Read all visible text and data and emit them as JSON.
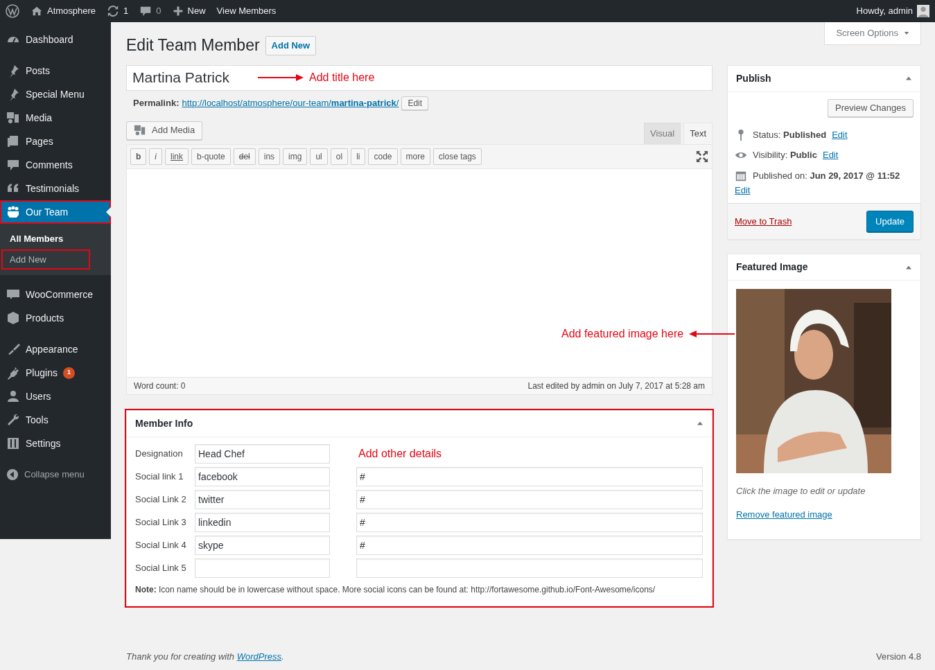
{
  "admin_bar": {
    "site": "Atmosphere",
    "updates": "1",
    "comments": "0",
    "new": "New",
    "view": "View Members",
    "greeting": "Howdy, admin"
  },
  "sidebar": {
    "groups": [
      [
        {
          "label": "Dashboard",
          "selected": false,
          "highlighted": false
        }
      ],
      [
        {
          "label": "Posts",
          "selected": false,
          "highlighted": false
        },
        {
          "label": "Special Menu",
          "selected": false,
          "highlighted": false
        },
        {
          "label": "Media",
          "selected": false,
          "highlighted": false
        },
        {
          "label": "Pages",
          "selected": false,
          "highlighted": false
        },
        {
          "label": "Comments",
          "selected": false,
          "highlighted": false
        },
        {
          "label": "Testimonials",
          "selected": false,
          "highlighted": false
        },
        {
          "label": "Our Team",
          "selected": true,
          "highlighted": true,
          "children": [
            {
              "label": "All Members",
              "selected": true,
              "highlighted": false
            },
            {
              "label": "Add New",
              "selected": false,
              "highlighted": true
            }
          ]
        }
      ],
      [
        {
          "label": "WooCommerce",
          "selected": false,
          "highlighted": false
        },
        {
          "label": "Products",
          "selected": false,
          "highlighted": false
        }
      ],
      [
        {
          "label": "Appearance",
          "selected": false,
          "highlighted": false
        },
        {
          "label": "Plugins",
          "selected": false,
          "highlighted": false,
          "badge": "1"
        },
        {
          "label": "Users",
          "selected": false,
          "highlighted": false
        },
        {
          "label": "Tools",
          "selected": false,
          "highlighted": false
        },
        {
          "label": "Settings",
          "selected": false,
          "highlighted": false
        }
      ]
    ],
    "collapse": "Collapse menu"
  },
  "screen_options": "Screen Options",
  "page": {
    "title": "Edit Team Member",
    "add_new": "Add New"
  },
  "post_title": {
    "value": "Martina Patrick"
  },
  "permalink": {
    "label": "Permalink:",
    "url": "http://localhost/atmosphere/our-team/**martina-patrick**/",
    "edit": "Edit"
  },
  "editor": {
    "add_media": "Add Media",
    "tabs": [
      {
        "label": "Visual",
        "selected": false
      },
      {
        "label": "Text",
        "selected": true
      }
    ],
    "quicktags": [
      "b",
      "i",
      "link",
      "b-quote",
      "del",
      "ins",
      "img",
      "ul",
      "ol",
      "li",
      "code",
      "more",
      "close tags"
    ],
    "word_count": "Word count: 0",
    "last_edited": "Last edited by admin on July 7, 2017 at 5:28 am"
  },
  "member_info": {
    "title": "Member Info",
    "highlighted": true,
    "rows": [
      {
        "kind": "text",
        "label": "Designation",
        "name": "Head Chef"
      },
      {
        "kind": "social",
        "label": "Social link 1",
        "name": "facebook",
        "url": "#"
      },
      {
        "kind": "social",
        "label": "Social Link 2",
        "name": "twitter",
        "url": "#"
      },
      {
        "kind": "social",
        "label": "Social Link 3",
        "name": "linkedin",
        "url": "#"
      },
      {
        "kind": "social",
        "label": "Social Link 4",
        "name": "skype",
        "url": "#"
      },
      {
        "kind": "social",
        "label": "Social Link 5"
      }
    ],
    "note": "**Note:** Icon name should be in lowercase without space. More social icons can be found at: http://fortawesome.github.io/Font-Awesome/icons/"
  },
  "publish": {
    "title": "Publish",
    "preview": "Preview Changes",
    "lines": [
      {
        "kind": "status",
        "label": "Status:",
        "value": "Published",
        "edit": "Edit"
      },
      {
        "kind": "visibility",
        "label": "Visibility:",
        "value": "Public",
        "edit": "Edit"
      },
      {
        "kind": "date",
        "label": "Published on:",
        "value": "Jun 29, 2017 @ 11:52",
        "edit": "Edit"
      }
    ],
    "trash": "Move to Trash",
    "update": "Update"
  },
  "featured_image": {
    "title": "Featured Image",
    "hint": "Click the image to edit or update",
    "remove": "Remove featured image"
  },
  "annotations": [
    {
      "kind": "title",
      "text": "Add title here"
    },
    {
      "text": "Add featured image here"
    },
    {
      "kind": "details",
      "text": "Add other details"
    }
  ],
  "footer": {
    "thanks": "Thank you for creating with",
    "link": "WordPress",
    "end": ".",
    "version": "Version 4.8"
  }
}
